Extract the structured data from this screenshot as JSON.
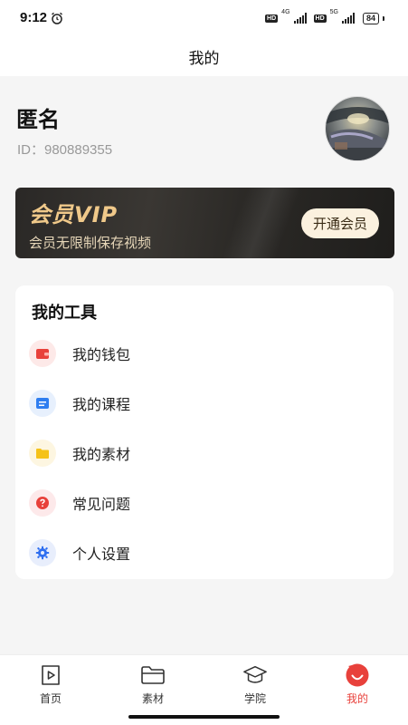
{
  "status_bar": {
    "time": "9:12",
    "hd_badge": "HD",
    "network_1": "4G",
    "network_2": "5G",
    "battery": "84"
  },
  "header": {
    "title": "我的"
  },
  "profile": {
    "name": "匿名",
    "id_text": "ID：980889355"
  },
  "vip": {
    "title": "会员VIP",
    "subtitle": "会员无限制保存视频",
    "button_label": "开通会员",
    "accent_color": "#f0c98a"
  },
  "tools": {
    "title": "我的工具",
    "items": [
      {
        "label": "我的钱包",
        "icon": "wallet-icon",
        "color": "#e8413b"
      },
      {
        "label": "我的课程",
        "icon": "course-icon",
        "color": "#2f7ef0"
      },
      {
        "label": "我的素材",
        "icon": "folder-icon",
        "color": "#f5c21a"
      },
      {
        "label": "常见问题",
        "icon": "question-icon",
        "color": "#e8413b"
      },
      {
        "label": "个人设置",
        "icon": "gear-icon",
        "color": "#2f6ff0"
      }
    ]
  },
  "tabs": [
    {
      "label": "首页",
      "icon": "play-icon",
      "active": false
    },
    {
      "label": "素材",
      "icon": "folder-icon",
      "active": false
    },
    {
      "label": "学院",
      "icon": "graduation-cap-icon",
      "active": false
    },
    {
      "label": "我的",
      "icon": "profile-smile-icon",
      "active": true,
      "color": "#e8413b"
    }
  ]
}
